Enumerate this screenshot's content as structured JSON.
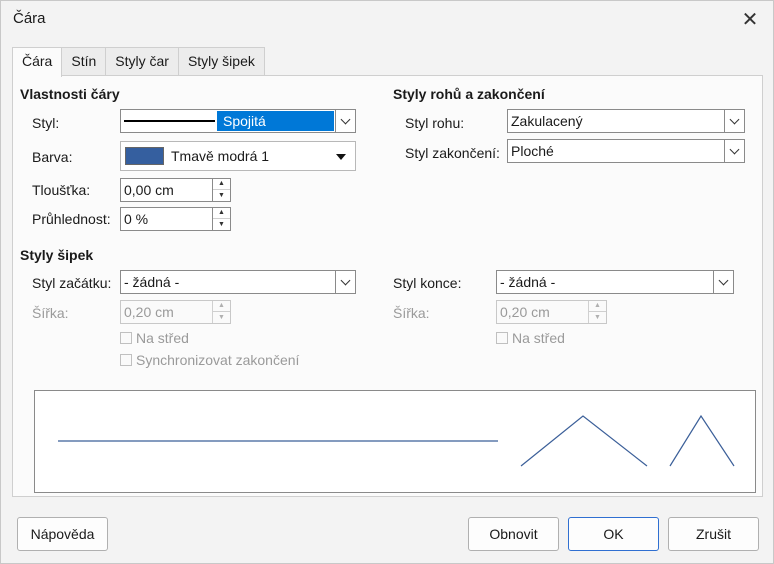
{
  "window": {
    "title": "Čára",
    "close_glyph": "✕"
  },
  "tabs": [
    {
      "label": "Čára",
      "active": true
    },
    {
      "label": "Stín",
      "active": false
    },
    {
      "label": "Styly čar",
      "active": false
    },
    {
      "label": "Styly šipek",
      "active": false
    }
  ],
  "line_properties": {
    "title": "Vlastnosti čáry",
    "style_label": "Styl:",
    "style_value": "Spojitá",
    "color_label": "Barva:",
    "color_value": "Tmavě modrá 1",
    "color_swatch": "#355f9f",
    "width_label": "Tloušťka:",
    "width_value": "0,00 cm",
    "transparency_label": "Průhlednost:",
    "transparency_value": "0 %"
  },
  "corner_cap": {
    "title": "Styly rohů a zakončení",
    "corner_label": "Styl rohu:",
    "corner_value": "Zakulacený",
    "cap_label": "Styl zakončení:",
    "cap_value": "Ploché"
  },
  "arrow_styles": {
    "title": "Styly šipek",
    "start_label": "Styl začátku:",
    "start_value": "- žádná -",
    "end_label": "Styl konce:",
    "end_value": "- žádná -",
    "start_width_label": "Šířka:",
    "start_width_value": "0,20 cm",
    "end_width_label": "Šířka:",
    "end_width_value": "0,20 cm",
    "start_center_label": "Na střed",
    "end_center_label": "Na střed",
    "sync_label": "Synchronizovat zakončení"
  },
  "preview": {
    "line_color": "#3b5f99"
  },
  "buttons": {
    "help": "Nápověda",
    "reset": "Obnovit",
    "ok": "OK",
    "cancel": "Zrušit"
  },
  "colors": {
    "selection": "#0078d7",
    "default_button_border": "#2f6fd1"
  }
}
